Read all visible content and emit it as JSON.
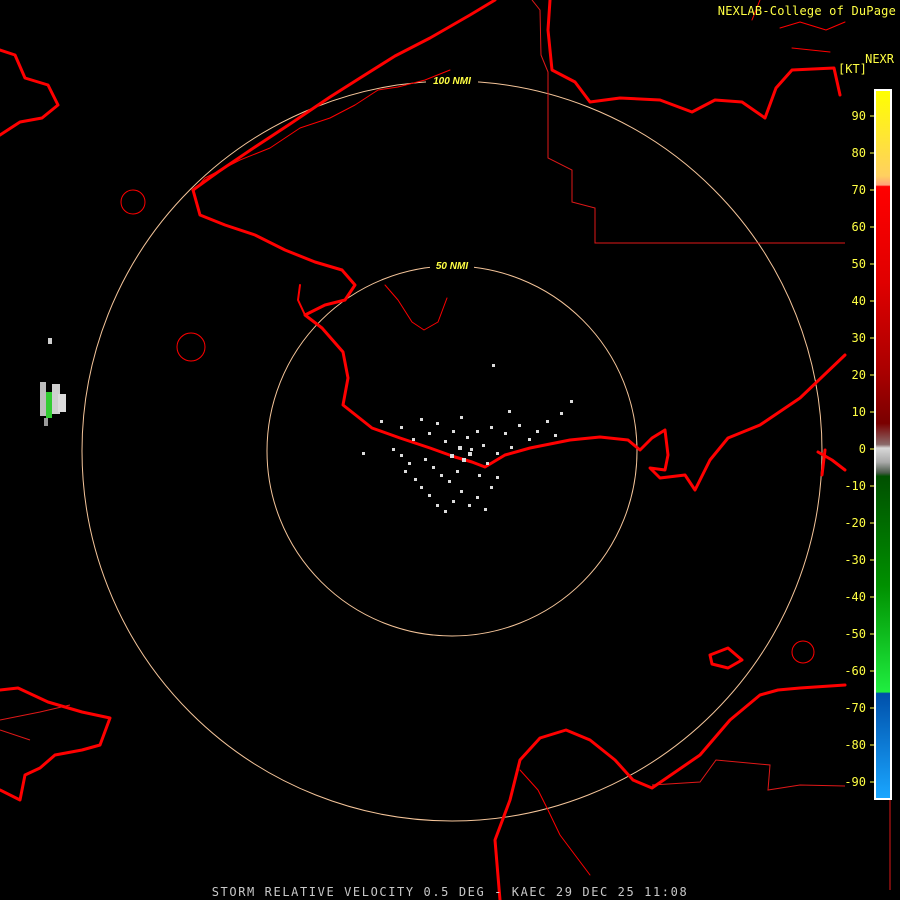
{
  "header": {
    "credit": "NEXLAB-College of DuPage",
    "product": "NEXR",
    "units": "[KT]"
  },
  "footer": {
    "caption": "STORM RELATIVE VELOCITY 0.5 DEG - KAEC 29 DEC 25 11:08"
  },
  "range_rings": [
    {
      "label": "50 NMI"
    },
    {
      "label": "100 NMI"
    }
  ],
  "legend": {
    "ticks": [
      "90",
      "80",
      "70",
      "60",
      "50",
      "40",
      "30",
      "20",
      "10",
      "0",
      "-10",
      "-20",
      "-30",
      "-40",
      "-50",
      "-60",
      "-70",
      "-80",
      "-90"
    ],
    "colors": {
      "label": "#ffff44",
      "ring": "#f5c59a",
      "border": "#ff0000",
      "boundary": "#e01818"
    }
  }
}
